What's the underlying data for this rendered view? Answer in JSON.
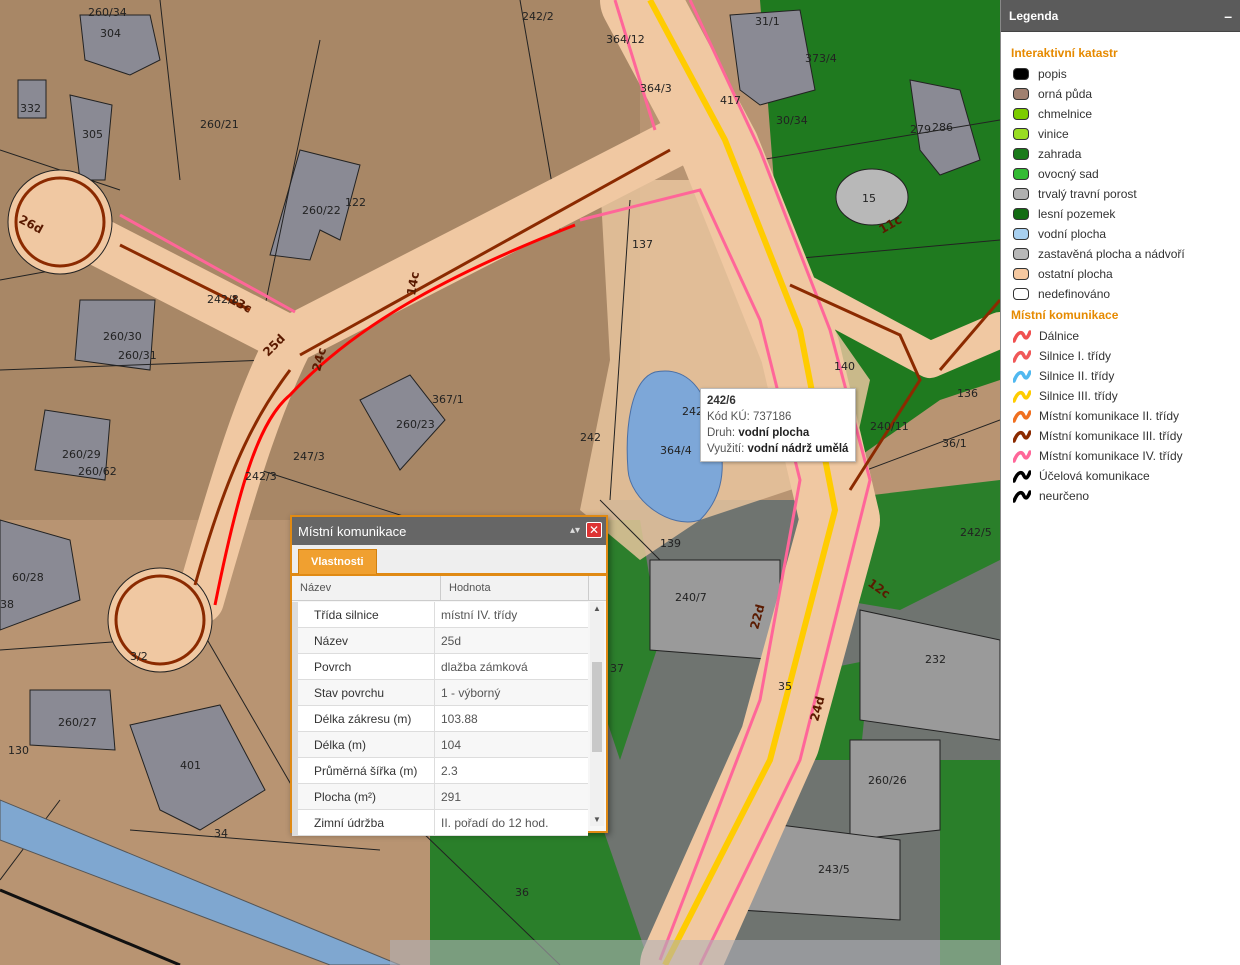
{
  "map": {
    "parcels": [
      "260/34",
      "304",
      "242/2",
      "31/1",
      "332",
      "305",
      "260/21",
      "364/12",
      "364/3",
      "417",
      "373/4",
      "30/34",
      "279",
      "286",
      "260/22",
      "122",
      "15",
      "11c",
      "14c",
      "26d",
      "13c",
      "242/8",
      "137",
      "260/30",
      "260/31",
      "25d",
      "24c",
      "242/3",
      "140",
      "260/23",
      "367/1",
      "136",
      "260/29",
      "260/62",
      "247/3",
      "242",
      "242/6",
      "364/4",
      "240/11",
      "36/1",
      "242/5",
      "139",
      "60/28",
      "38",
      "240/7",
      "12c",
      "3/2",
      "37",
      "232",
      "260/27",
      "130",
      "401",
      "24d",
      "22d",
      "35",
      "260/26",
      "34",
      "243/5",
      "36"
    ]
  },
  "tooltip": {
    "title": "242/6",
    "code_label": "Kód KÚ:",
    "code_value": "737186",
    "kind_label": "Druh:",
    "kind_value": "vodní plocha",
    "use_label": "Využití:",
    "use_value": "vodní nádrž umělá"
  },
  "panel": {
    "title": "Místní komunikace",
    "tab": "Vlastnosti",
    "col_name": "Název",
    "col_value": "Hodnota",
    "rows": [
      {
        "k": "Třída silnice",
        "v": "místní IV. třídy"
      },
      {
        "k": "Název",
        "v": "25d"
      },
      {
        "k": "Povrch",
        "v": "dlažba zámková"
      },
      {
        "k": "Stav povrchu",
        "v": "1 - výborný"
      },
      {
        "k": "Délka zákresu (m)",
        "v": "103.88"
      },
      {
        "k": "Délka (m)",
        "v": "104"
      },
      {
        "k": "Průměrná šířka (m)",
        "v": "2.3"
      },
      {
        "k": "Plocha (m²)",
        "v": "291"
      },
      {
        "k": "Zimní údržba",
        "v": "II. pořadí do 12 hod."
      }
    ]
  },
  "legend": {
    "title": "Legenda",
    "minimize": "–",
    "section1": "Interaktivní katastr",
    "items1": [
      {
        "label": "popis",
        "color": "#000000"
      },
      {
        "label": "orná půda",
        "color": "#a08070"
      },
      {
        "label": "chmelnice",
        "color": "#7ccc00"
      },
      {
        "label": "vinice",
        "color": "#99dd22"
      },
      {
        "label": "zahrada",
        "color": "#1a7a1a"
      },
      {
        "label": "ovocný sad",
        "color": "#33bb33"
      },
      {
        "label": "trvalý travní porost",
        "color": "#b0b0b0"
      },
      {
        "label": "lesní pozemek",
        "color": "#136b13"
      },
      {
        "label": "vodní plocha",
        "color": "#a8d0f0"
      },
      {
        "label": "zastavěná plocha a nádvoří",
        "color": "#b8b8b8"
      },
      {
        "label": "ostatní plocha",
        "color": "#f5c8a0"
      },
      {
        "label": "nedefinováno",
        "color": "#ffffff"
      }
    ],
    "section2": "Místní komunikace",
    "items2": [
      {
        "label": "Dálnice",
        "color": "#f05050"
      },
      {
        "label": "Silnice I. třídy",
        "color": "#f05858"
      },
      {
        "label": "Silnice II. třídy",
        "color": "#50b8f0"
      },
      {
        "label": "Silnice III. třídy",
        "color": "#ffcc00"
      },
      {
        "label": "Místní komunikace II. třídy",
        "color": "#f07020"
      },
      {
        "label": "Místní komunikace III. třídy",
        "color": "#8b2a00"
      },
      {
        "label": "Místní komunikace IV. třídy",
        "color": "#ff6699"
      },
      {
        "label": "Účelová komunikace",
        "color": "#000000"
      },
      {
        "label": "neurčeno",
        "color": "#000000"
      }
    ]
  }
}
